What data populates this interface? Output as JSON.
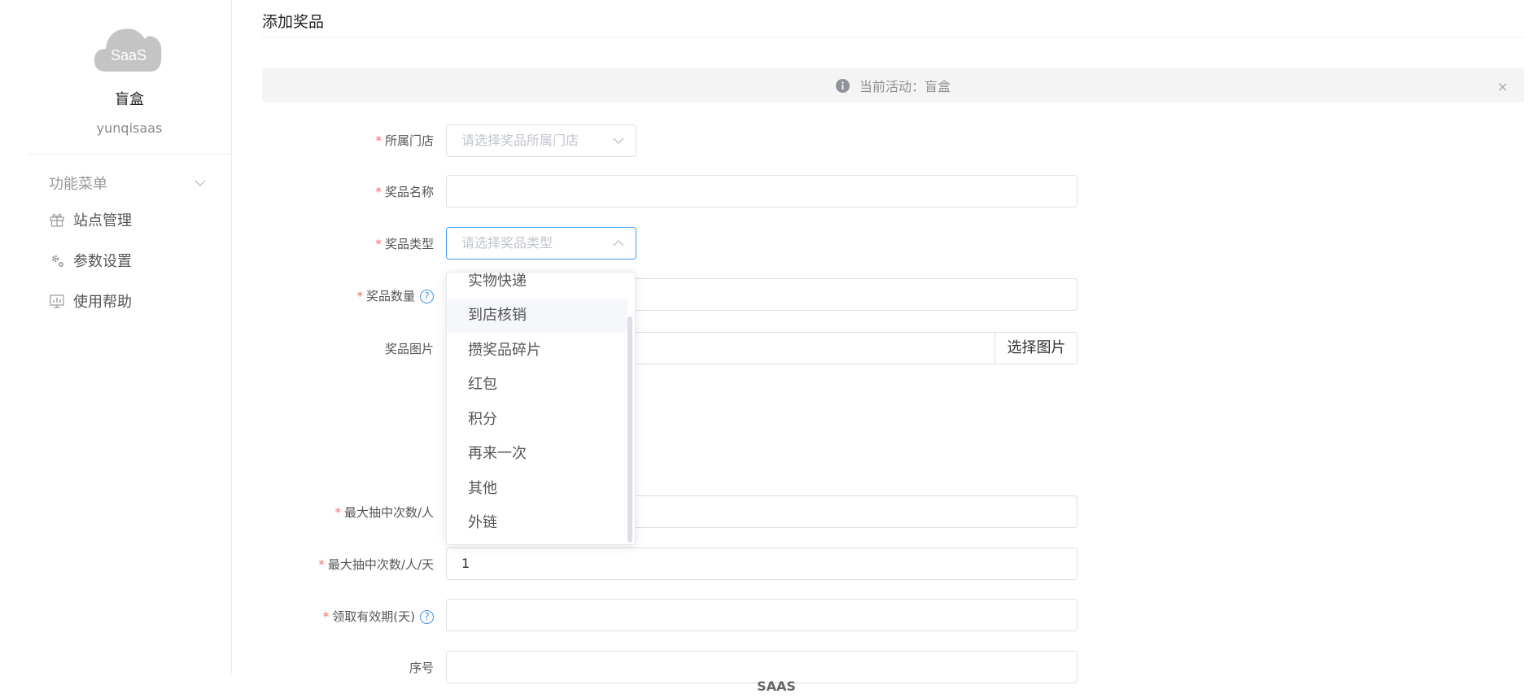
{
  "sidebar": {
    "logo_text": "SaaS",
    "site_name": "盲盒",
    "site_user": "yunqisaas",
    "menu_title": "功能菜单",
    "items": [
      {
        "label": "站点管理",
        "icon": "gift-icon"
      },
      {
        "label": "参数设置",
        "icon": "gear-icon"
      },
      {
        "label": "使用帮助",
        "icon": "chart-icon"
      }
    ]
  },
  "page": {
    "title": "添加奖品",
    "alert": "当前活动：盲盒",
    "alert_close": "×"
  },
  "form": {
    "required_mark": "*",
    "help_mark": "?",
    "store": {
      "label": "所属门店",
      "placeholder": "请选择奖品所属门店"
    },
    "name": {
      "label": "奖品名称",
      "value": ""
    },
    "type": {
      "label": "奖品类型",
      "placeholder": "请选择奖品类型"
    },
    "quantity": {
      "label": "奖品数量",
      "value": ""
    },
    "image": {
      "label": "奖品图片",
      "button": "选择图片",
      "value": ""
    },
    "max_per_person": {
      "label": "最大抽中次数/人",
      "value": ""
    },
    "max_per_person_day": {
      "label": "最大抽中次数/人/天",
      "value": "1"
    },
    "valid_days": {
      "label": "领取有效期(天)",
      "value": ""
    },
    "order": {
      "label": "序号",
      "value": ""
    }
  },
  "dropdown": {
    "options": [
      "实物快递",
      "到店核销",
      "攒奖品碎片",
      "红包",
      "积分",
      "再来一次",
      "其他",
      "外链"
    ],
    "hovered": "到店核销"
  },
  "footer": "SAAS",
  "colors": {
    "accent": "#409eff",
    "required": "#f56c6c",
    "help": "#4a90e2"
  }
}
